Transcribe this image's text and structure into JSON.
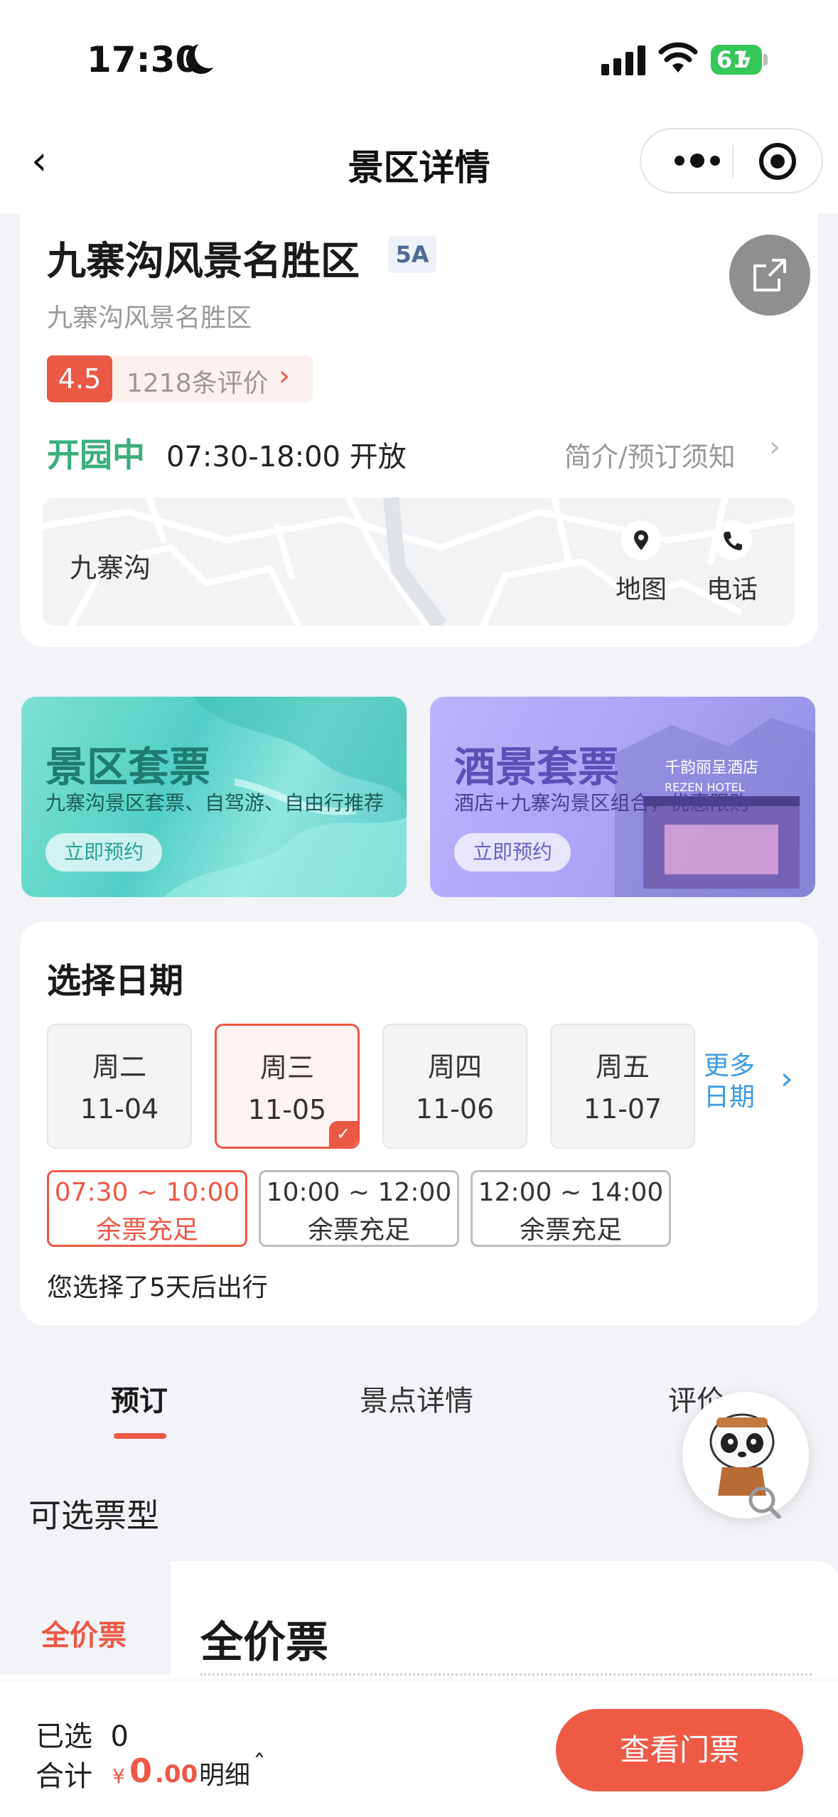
{
  "status_bar": {
    "time": "17:30",
    "battery": "61"
  },
  "nav": {
    "title": "景区详情"
  },
  "scenic": {
    "name": "九寨沟风景名胜区",
    "level": "5A",
    "subname": "九寨沟风景名胜区",
    "rating": "4.5",
    "reviews": "1218条评价",
    "open_status": "开园中",
    "hours": "07:30-18:00 开放",
    "notice_link": "简介/预订须知"
  },
  "map": {
    "place": "九寨沟",
    "map_label": "地图",
    "phone_label": "电话"
  },
  "promos": [
    {
      "title": "景区套票",
      "subtitle": "九寨沟景区套票、自驾游、自由行推荐",
      "button": "立即预约"
    },
    {
      "title": "酒景套票",
      "subtitle": "酒店+九寨沟景区组合，优惠限购",
      "button": "立即预约",
      "hotel_brand": "千韵丽呈酒店",
      "hotel_brand_en": "REZEN HOTEL"
    }
  ],
  "date_picker": {
    "title": "选择日期",
    "days": [
      {
        "weekday": "周二",
        "date": "11-04"
      },
      {
        "weekday": "周三",
        "date": "11-05"
      },
      {
        "weekday": "周四",
        "date": "11-06"
      },
      {
        "weekday": "周五",
        "date": "11-07"
      }
    ],
    "selected_day": "11-05",
    "more": "更多日期",
    "slots": [
      {
        "time": "07:30 ~ 10:00",
        "remain": "余票充足"
      },
      {
        "time": "10:00 ~ 12:00",
        "remain": "余票充足"
      },
      {
        "time": "12:00 ~ 14:00",
        "remain": "余票充足"
      }
    ],
    "selected_slot": "07:30 ~ 10:00",
    "travel_hint": "您选择了5天后出行"
  },
  "tabs": [
    "预订",
    "景点详情",
    "评价"
  ],
  "active_tab": "预订",
  "tickets": {
    "section_title": "可选票型",
    "category": "全价票",
    "name": "全价票"
  },
  "footer": {
    "selected_label": "已选",
    "selected_count": "0",
    "total_label": "合计",
    "currency": "¥",
    "amount_int": "0",
    "amount_dec": ".00",
    "detail": "明细",
    "cta": "查看门票"
  },
  "colors": {
    "accent": "#ec5846",
    "open_green": "#3aae7c",
    "link_blue": "#3b9ae1"
  }
}
